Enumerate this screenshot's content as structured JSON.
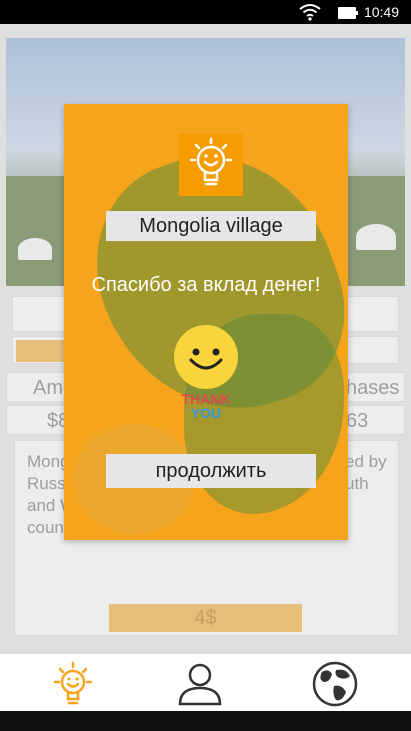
{
  "status_bar": {
    "time": "10:49",
    "icons": [
      "wifi-icon",
      "battery-icon"
    ]
  },
  "background": {
    "field_amount_label": "Amo",
    "field_purchases_label": "hases",
    "field_amount_value": "$8",
    "field_purchases_value": "63",
    "description_lines_left": [
      "Mong",
      "Russi",
      "and W",
      "count"
    ],
    "description_lines_right": [
      "ed by",
      "uth"
    ],
    "donate_button": "4$"
  },
  "dialog": {
    "icon": "lightbulb-icon",
    "title": "Mongolia village",
    "message": "Спасибо за вклад денег!",
    "thank_line1": "THANK",
    "thank_line2": "YOU",
    "continue_button": "продолжить"
  },
  "bottom_nav": {
    "items": [
      {
        "name": "lightbulb-icon",
        "active": true
      },
      {
        "name": "profile-icon",
        "active": false
      },
      {
        "name": "globe-icon",
        "active": false
      }
    ]
  },
  "colors": {
    "accent": "#f5a41c",
    "muted_accent": "#e2b15b",
    "green_overlay": "#5a8c3c"
  }
}
